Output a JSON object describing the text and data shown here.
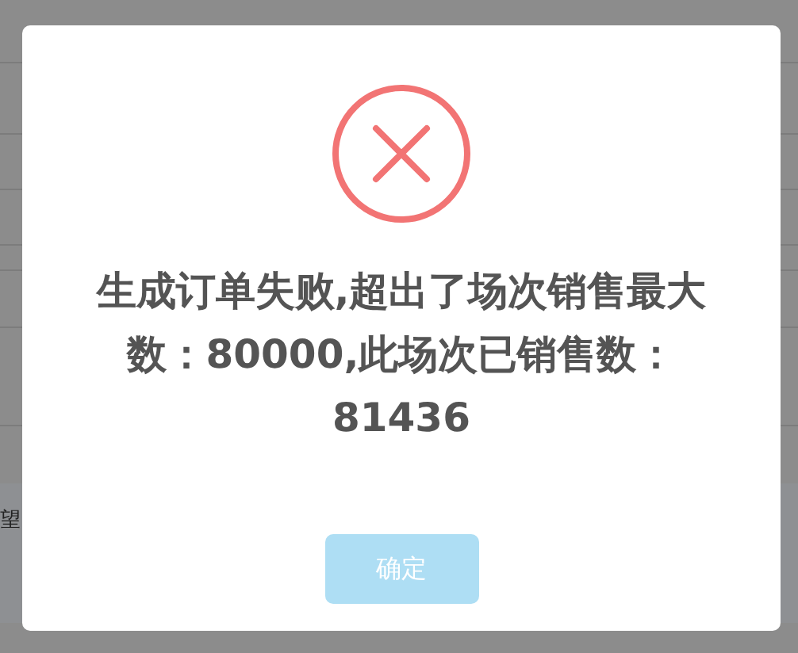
{
  "background_page": {
    "bottom_bar": {
      "left": "望"
    }
  },
  "dialog": {
    "title": "生成订单失败,超出了场次销售最大数：80000,此场次已销售数：81436",
    "confirm_button": {
      "label": "确定",
      "disabled": true
    }
  }
}
